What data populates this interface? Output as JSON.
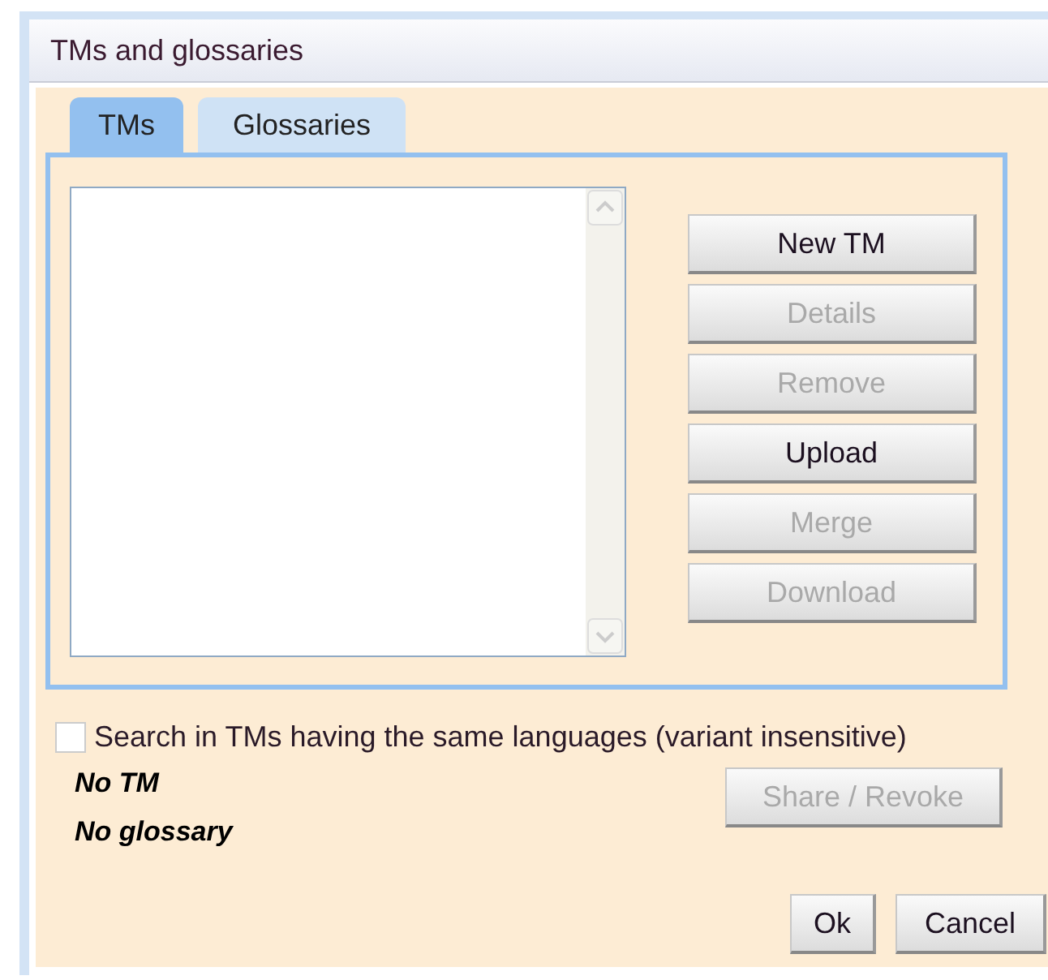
{
  "window": {
    "title": "TMs and glossaries"
  },
  "tabs": [
    {
      "label": "TMs",
      "selected": true
    },
    {
      "label": "Glossaries",
      "selected": false
    }
  ],
  "buttons": [
    {
      "label": "New TM",
      "disabled": false
    },
    {
      "label": "Details",
      "disabled": true
    },
    {
      "label": "Remove",
      "disabled": true
    },
    {
      "label": "Upload",
      "disabled": false
    },
    {
      "label": "Merge",
      "disabled": true
    },
    {
      "label": "Download",
      "disabled": true
    }
  ],
  "search_option": {
    "label": "Search in TMs having the same languages (variant insensitive)",
    "checked": false
  },
  "status": [
    "No TM",
    "No glossary"
  ],
  "share_button": {
    "label": "Share / Revoke",
    "disabled": true
  },
  "footer_buttons": [
    "Ok",
    "Cancel"
  ]
}
